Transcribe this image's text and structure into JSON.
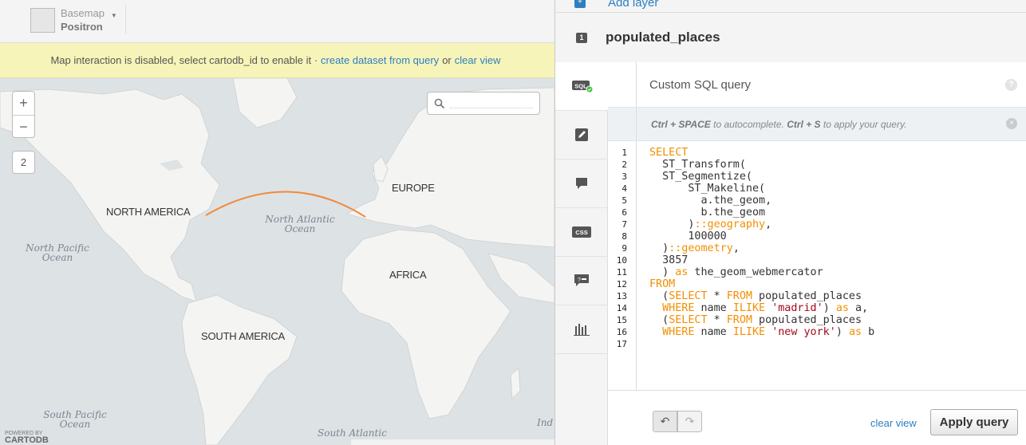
{
  "basemap": {
    "label": "Basemap",
    "value": "Positron"
  },
  "notice": {
    "text": "Map interaction is disabled, select cartodb_id to enable it ·",
    "create_link": "create dataset from query",
    "or": "or",
    "clear_link": "clear view"
  },
  "map": {
    "zoom_in": "+",
    "zoom_out": "−",
    "zoom_level": "2",
    "search_placeholder": "",
    "continents": {
      "north_america": "NORTH AMERICA",
      "europe": "EUROPE",
      "africa": "AFRICA",
      "south_america": "SOUTH AMERICA"
    },
    "oceans": {
      "north_atlantic_1": "North Atlantic",
      "north_atlantic_2": "Ocean",
      "north_pacific_1": "North Pacific",
      "north_pacific_2": "Ocean",
      "south_pacific_1": "South Pacific",
      "south_pacific_2": "Ocean",
      "south_atlantic": "South Atlantic",
      "indian": "Ind"
    },
    "powered_by": "POWERED BY",
    "brand": "CARTODB",
    "route_color": "#f08a3a"
  },
  "panel": {
    "add_layer": "Add layer",
    "layer_number": "1",
    "layer_name": "populated_places",
    "tabs": [
      "sql-icon",
      "wizard-icon",
      "infowindow-icon",
      "css-icon",
      "legend-icon",
      "filters-icon"
    ],
    "sql_title": "Custom SQL query",
    "help": "?",
    "hint": {
      "k1": "Ctrl + SPACE",
      "t1": " to autocomplete. ",
      "k2": "Ctrl + S",
      "t2": " to apply your query."
    },
    "close": "×",
    "line_numbers": [
      "1",
      "2",
      "3",
      "4",
      "5",
      "6",
      "7",
      "8",
      "9",
      "10",
      "11",
      "12",
      "13",
      "14",
      "15",
      "16",
      "17"
    ],
    "undo": "↶",
    "redo": "↷",
    "clear_view": "clear view",
    "apply": "Apply query"
  },
  "colors": {
    "accent": "#2d7fc0",
    "keyword": "#f18f01",
    "string": "#a0091c",
    "notice_bg": "#f7f4b9"
  }
}
